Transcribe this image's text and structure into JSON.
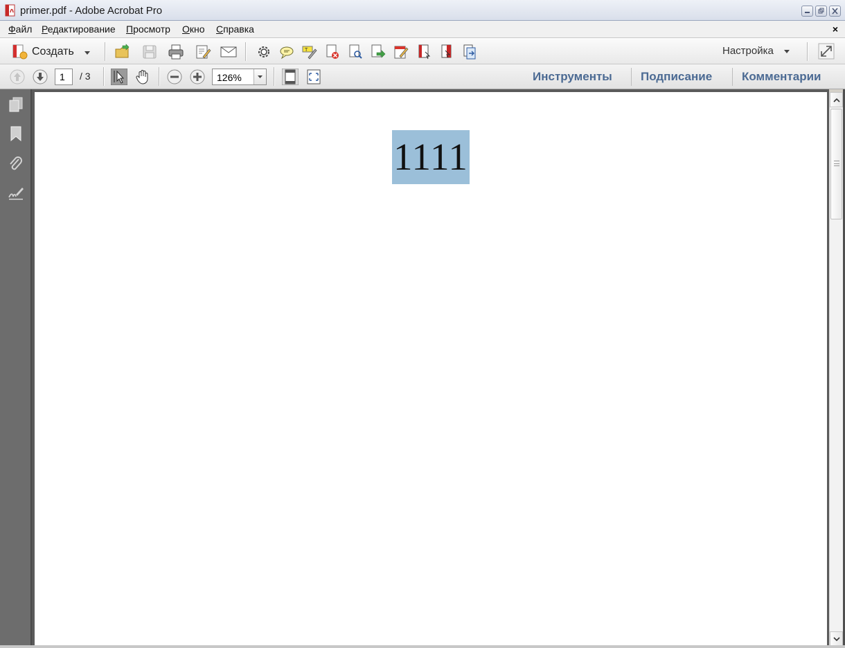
{
  "window": {
    "title": "primer.pdf - Adobe Acrobat Pro",
    "app_icon": "acrobat-pdf-icon",
    "controls": [
      "minimize-icon",
      "restore-icon",
      "close-icon"
    ]
  },
  "menubar": {
    "items": [
      {
        "label": "Файл"
      },
      {
        "label": "Редактирование"
      },
      {
        "label": "Просмотр"
      },
      {
        "label": "Окно"
      },
      {
        "label": "Справка"
      }
    ],
    "close_glyph": "×"
  },
  "toolbar": {
    "create_label": "Создать",
    "icons": [
      "open-folder-icon",
      "save-icon",
      "print-icon",
      "edit-icon",
      "email-icon",
      "gear-icon",
      "comment-icon",
      "highlight-icon",
      "delete-page-icon",
      "find-icon",
      "export-icon",
      "sign-icon",
      "insert-page-icon",
      "extract-page-icon",
      "replace-page-icon"
    ],
    "customize_label": "Настройка",
    "expand_icon": "fullscreen-icon"
  },
  "navbar": {
    "current_page": "1",
    "page_total": "/ 3",
    "zoom_value": "126%",
    "panes": [
      {
        "label": "Инструменты"
      },
      {
        "label": "Подписание"
      },
      {
        "label": "Комментарии"
      }
    ]
  },
  "sidepanel": {
    "icons": [
      "pages-icon",
      "bookmark-icon",
      "attachment-icon",
      "signature-icon"
    ]
  },
  "document": {
    "page_text": "1111"
  },
  "colors": {
    "selection_highlight": "#9bbfd9",
    "pane_link": "#4b6a93",
    "side_panel": "#6d6d6d"
  }
}
